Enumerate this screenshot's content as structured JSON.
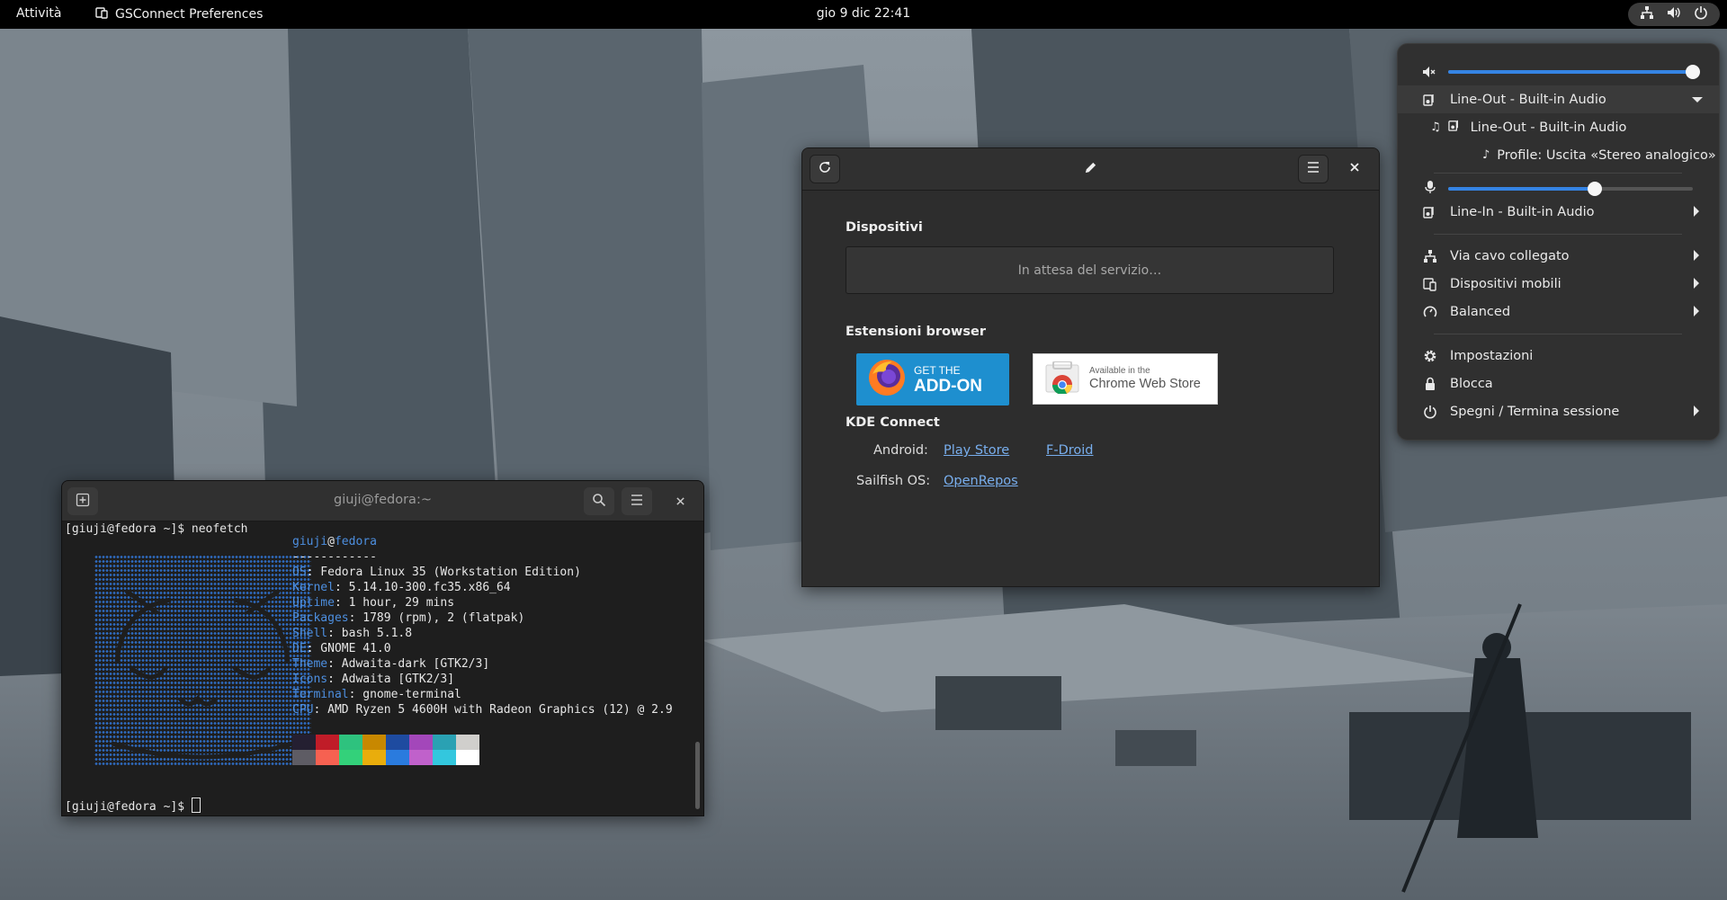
{
  "topbar": {
    "activities": "Attività",
    "app_name": "GSConnect Preferences",
    "clock": "gio 9 dic  22:41",
    "tray_icons": [
      "network-wired-icon",
      "volume-icon",
      "power-icon"
    ]
  },
  "system_menu": {
    "output_volume": 1.0,
    "output_device": "Line-Out - Built-in Audio",
    "output_sub_device": "Line-Out - Built-in Audio",
    "output_profile": "Profile: Uscita «Stereo analogico»",
    "input_volume": 0.6,
    "input_device": "Line-In - Built-in Audio",
    "wired": "Via cavo collegato",
    "mobile_devices": "Dispositivi mobili",
    "power_profile": "Balanced",
    "settings": "Impostazioni",
    "lock": "Blocca",
    "power_off": "Spegni / Termina sessione"
  },
  "gsconnect": {
    "devices_title": "Dispositivi",
    "waiting": "In attesa del servizio…",
    "browser_title": "Estensioni browser",
    "firefox_line1": "GET THE",
    "firefox_line2": "ADD-ON",
    "chrome_line1": "Available in the",
    "chrome_line2": "Chrome Web Store",
    "kde_title": "KDE Connect",
    "android_label": "Android:",
    "play_store": "Play Store",
    "fdroid": "F-Droid",
    "sailfish_label": "Sailfish OS:",
    "openrepos": "OpenRepos"
  },
  "terminal": {
    "title": "giuji@fedora:~",
    "cmd_line": "[giuji@fedora ~]$ neofetch",
    "user": "giuji",
    "host": "fedora",
    "separator": "------------",
    "info": [
      {
        "key": "OS",
        "value": ": Fedora Linux 35 (Workstation Edition)"
      },
      {
        "key": "Kernel",
        "value": ": 5.14.10-300.fc35.x86_64"
      },
      {
        "key": "Uptime",
        "value": ": 1 hour, 29 mins"
      },
      {
        "key": "Packages",
        "value": ": 1789 (rpm), 2 (flatpak)"
      },
      {
        "key": "Shell",
        "value": ": bash 5.1.8"
      },
      {
        "key": "DE",
        "value": ": GNOME 41.0"
      },
      {
        "key": "Theme",
        "value": ": Adwaita-dark [GTK2/3]"
      },
      {
        "key": "Icons",
        "value": ": Adwaita [GTK2/3]"
      },
      {
        "key": "Terminal",
        "value": ": gnome-terminal"
      },
      {
        "key": "CPU",
        "value": ": AMD Ryzen 5 4600H with Radeon Graphics (12) @ 2.9"
      }
    ],
    "palette_top": [
      "#241f31",
      "#c01c28",
      "#2ec27e",
      "#c88800",
      "#1e4ba0",
      "#a347ba",
      "#2aa1b3",
      "#d0cfcc"
    ],
    "palette_bottom": [
      "#5e5c64",
      "#f66151",
      "#33d17a",
      "#e9ad0c",
      "#2a7bde",
      "#c061cb",
      "#33c7de",
      "#ffffff"
    ],
    "prompt": "[giuji@fedora ~]$ "
  }
}
